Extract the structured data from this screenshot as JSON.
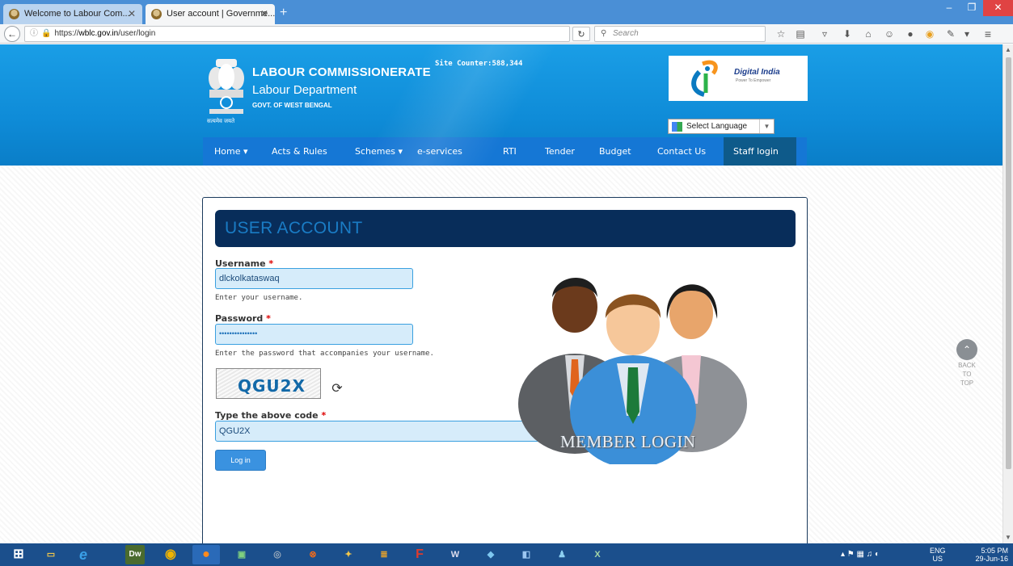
{
  "browser": {
    "tabs": [
      {
        "title": "Welcome to Labour Com...",
        "active": false
      },
      {
        "title": "User account | Governme...",
        "active": true
      }
    ],
    "url_prefix": "https://",
    "url_domain": "wblc.gov.in",
    "url_path": "/user/login",
    "search_placeholder": "Search",
    "window_controls": {
      "minimize": "–",
      "maximize": "❐",
      "close": "✕"
    }
  },
  "header": {
    "title": "LABOUR COMMISSIONERATE",
    "department": "Labour Department",
    "govt": "GOVT. OF WEST BENGAL",
    "motto": "सत्यमेव जयते",
    "site_counter": "Site Counter:588,344",
    "digital_india_title": "Digital India",
    "digital_india_tagline": "Power To Empower",
    "language_select": "Select Language",
    "language_arrow": "▼"
  },
  "nav": {
    "items": [
      {
        "label": "Home ▾"
      },
      {
        "label": "Acts & Rules"
      },
      {
        "label": "Schemes ▾"
      },
      {
        "label": "e-services"
      },
      {
        "label": "RTI"
      },
      {
        "label": "Tender"
      },
      {
        "label": "Budget"
      },
      {
        "label": "Contact Us"
      },
      {
        "label": "Staff login"
      }
    ]
  },
  "form": {
    "heading": "USER ACCOUNT",
    "username_label": "Username",
    "required_marker": "*",
    "username_value": "dlckolkataswaq",
    "username_desc": "Enter your username.",
    "password_label": "Password",
    "password_value": "•••••••••••••••",
    "password_desc": "Enter the password that accompanies your username.",
    "captcha_text": "QGU2X",
    "captcha_label": "Type the above code",
    "captcha_value": "QGU2X",
    "login_button": "Log in",
    "member_login_caption": "MEMBER LOGIN"
  },
  "back_to_top": [
    "BACK",
    "TO",
    "TOP"
  ],
  "taskbar": {
    "language": "ENG",
    "region": "US",
    "time": "5:05 PM",
    "date": "29-Jun-16"
  },
  "colors": {
    "header_blue": "#1a9ee6",
    "nav_blue": "#1577d5",
    "nav_active": "#0e5a8a",
    "panel_head": "#082d5a",
    "input_bg": "#d6ecfa",
    "button_blue": "#3a92e0"
  }
}
